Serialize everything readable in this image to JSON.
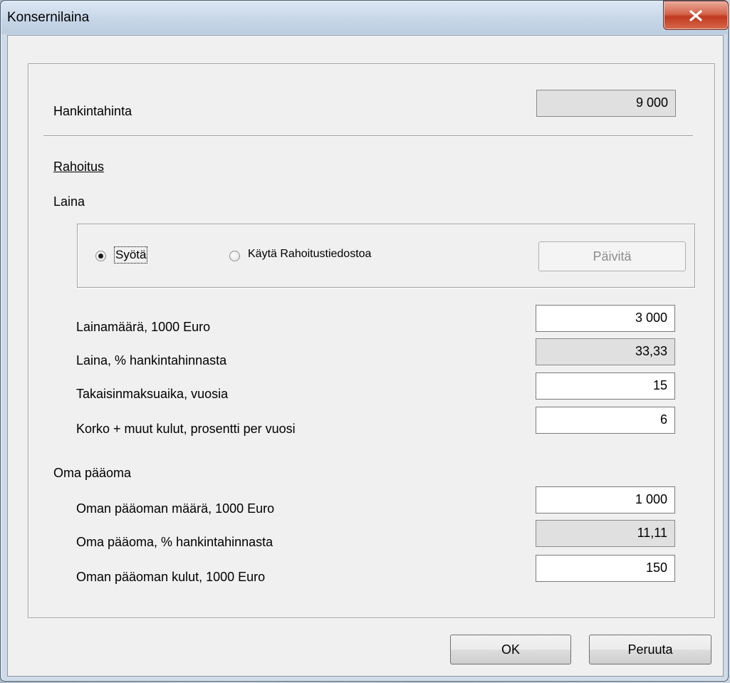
{
  "window": {
    "title": "Konsernilaina",
    "close_label": "x"
  },
  "purchase": {
    "label": "Hankintahinta",
    "value": "9 000"
  },
  "financing": {
    "heading": "Rahoitus",
    "loan_heading": "Laina",
    "radio_input_label": "Syötä",
    "radio_file_label": "Käytä Rahoitustiedostoa",
    "radio_selected": "Syötä",
    "update_button": "Päivitä"
  },
  "loan": {
    "amount_label": "Lainamäärä, 1000 Euro",
    "amount_value": "3 000",
    "percent_label": "Laina, % hankintahinnasta",
    "percent_value": "33,33",
    "term_label": "Takaisinmaksuaika, vuosia",
    "term_value": "15",
    "interest_label": "Korko + muut kulut, prosentti per vuosi",
    "interest_value": "6"
  },
  "equity": {
    "heading": "Oma pääoma",
    "amount_label": "Oman pääoman määrä, 1000 Euro",
    "amount_value": "1 000",
    "percent_label": "Oma pääoma, % hankintahinnasta",
    "percent_value": "11,11",
    "cost_label": "Oman pääoman kulut, 1000 Euro",
    "cost_value": "150"
  },
  "footer": {
    "ok_label": "OK",
    "cancel_label": "Peruuta"
  },
  "colors": {
    "close_button": "#c8452b",
    "dialog_bg": "#f0f0f0",
    "readonly_field": "#e0e0e0"
  }
}
